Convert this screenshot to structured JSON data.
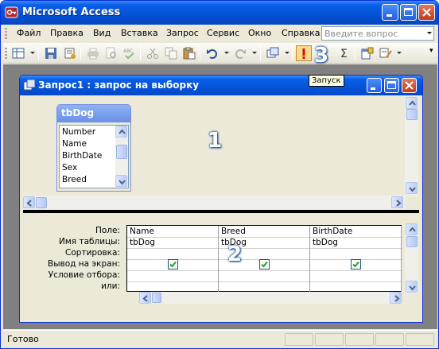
{
  "app": {
    "title": "Microsoft Access"
  },
  "menu": {
    "items": [
      {
        "label": "Файл"
      },
      {
        "label": "Правка"
      },
      {
        "label": "Вид"
      },
      {
        "label": "Вставка"
      },
      {
        "label": "Запрос"
      },
      {
        "label": "Сервис"
      },
      {
        "label": "Окно"
      },
      {
        "label": "Справка"
      }
    ],
    "help_placeholder": "Введите вопрос"
  },
  "toolbar": {
    "icons": [
      "view-icon",
      "save-icon",
      "properties-icon",
      "print-icon",
      "print-preview-icon",
      "spelling-icon",
      "cut-icon",
      "copy-icon",
      "paste-icon",
      "undo-icon",
      "redo-icon",
      "query-type-icon",
      "run-icon",
      "totals-icon",
      "show-table-icon",
      "builder-icon"
    ],
    "tooltip": "Запуск"
  },
  "query_window": {
    "title": "Запрос1 : запрос на выборку",
    "table": {
      "name": "tbDog",
      "fields": [
        "Number",
        "Name",
        "BirthDate",
        "Sex",
        "Breed"
      ]
    },
    "grid": {
      "row_labels": [
        "Поле:",
        "Имя таблицы:",
        "Сортировка:",
        "Вывод на экран:",
        "Условие отбора:",
        "или:"
      ],
      "columns": [
        {
          "field": "Name",
          "table": "tbDog",
          "show": true
        },
        {
          "field": "Breed",
          "table": "tbDog",
          "show": true
        },
        {
          "field": "BirthDate",
          "table": "tbDog",
          "show": true
        }
      ]
    }
  },
  "annotations": {
    "label_1": "1",
    "label_2": "2",
    "label_3": "3"
  },
  "status": {
    "text": "Готово"
  },
  "colors": {
    "titlebar": "#0453d6",
    "run_highlight": "#fbd98b",
    "badge_shadow": "#1f4f9e"
  }
}
